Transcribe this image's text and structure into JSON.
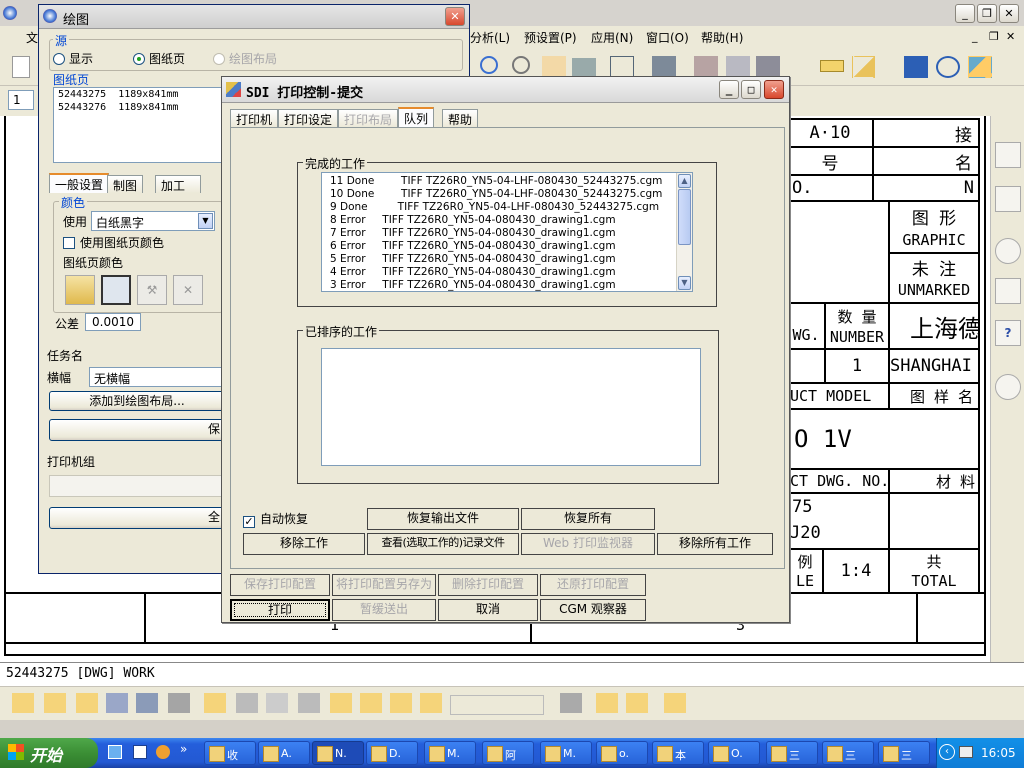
{
  "app": {
    "menu": [
      "分析(L)",
      "预设置(P)",
      "应用(N)",
      "窗口(O)",
      "帮助(H)"
    ],
    "left_menu_stub": "文",
    "zoom_field": "1"
  },
  "drawing": {
    "cells": {
      "a10": "A·10",
      "hao": "号",
      "no": "O.",
      "jie": "接",
      "ming": "名",
      "n": "N",
      "tuxing": "图 形",
      "graphic": "GRAPHIC",
      "weizhu": "未 注",
      "unmarked": "UNMARKED",
      "wg": "WG.",
      "shuliang": "数 量",
      "number": "NUMBER",
      "one": "1",
      "shanghai_cn": "上海德",
      "shanghai_en": "SHANGHAI",
      "uct_model": "UCT MODEL",
      "tuyangming": "图 样 名",
      "o1v": "O 1V",
      "ct_dwg": "CT DWG. NO.",
      "cailiao": "材 料",
      "n75": "75",
      "j20": "J20",
      "li": "例",
      "le": "LE",
      "scale": "1:4",
      "gong": "共",
      "total": "TOTAL",
      "bottom_a": "1",
      "bottom_b": "3"
    },
    "status": "52443275 [DWG] WORK"
  },
  "plot_window": {
    "title": "绘图",
    "source_group": "源",
    "radio_display": "显示",
    "radio_sheet": "图纸页",
    "radio_layout": "绘图布局",
    "sheets_group": "图纸页",
    "sheets": [
      {
        "name": "52443275",
        "size": "1189x841mm"
      },
      {
        "name": "52443276",
        "size": "1189x841mm"
      }
    ],
    "tabs": [
      "一般设置",
      "制图",
      "加工"
    ],
    "color_group": "颜色",
    "use_label": "使用",
    "use_value": "白纸黑字",
    "use_sheet_color": "使用图纸页颜色",
    "sheet_color_label": "图纸页颜色",
    "tolerance_label": "公差",
    "tolerance_value": "0.0010",
    "task_name_label": "任务名",
    "banner_label": "横幅",
    "banner_value": "无横幅",
    "add_to_layout": "添加到绘图布局...",
    "save_btn": "保",
    "printer_group_label": "打印机组",
    "all_btn": "全"
  },
  "sdi": {
    "title": "SDI 打印控制-提交",
    "tabs": [
      {
        "label": "打印机",
        "state": "normal"
      },
      {
        "label": "打印设定",
        "state": "normal"
      },
      {
        "label": "打印布局",
        "state": "disabled"
      },
      {
        "label": "队列",
        "state": "selected"
      },
      {
        "label": "帮助",
        "state": "normal"
      }
    ],
    "completed_group": "完成的工作",
    "completed_jobs": [
      "11 Done        TIFF TZ26R0_YN5-04-LHF-080430_52443275.cgm",
      "10 Done        TIFF TZ26R0_YN5-04-LHF-080430_52443275.cgm",
      "9 Done         TIFF TZ26R0_YN5-04-LHF-080430_52443275.cgm",
      "8 Error     TIFF TZ26R0_YN5-04-080430_drawing1.cgm",
      "7 Error     TIFF TZ26R0_YN5-04-080430_drawing1.cgm",
      "6 Error     TIFF TZ26R0_YN5-04-080430_drawing1.cgm",
      "5 Error     TIFF TZ26R0_YN5-04-080430_drawing1.cgm",
      "4 Error     TIFF TZ26R0_YN5-04-080430_drawing1.cgm",
      "3 Error     TIFF TZ26R0_YN5-04-080430_drawing1.cgm"
    ],
    "sorted_group": "已排序的工作",
    "auto_recover": "自动恢复",
    "btn_recover_output": "恢复输出文件",
    "btn_recover_all": "恢复所有",
    "btn_remove_job": "移除工作",
    "btn_view_log": "查看(选取工作的)记录文件",
    "btn_web_monitor": "Web 打印监视器",
    "btn_remove_all": "移除所有工作",
    "btn_save_config": "保存打印配置",
    "btn_save_as": "将打印配置另存为",
    "btn_delete_config": "删除打印配置",
    "btn_restore_config": "还原打印配置",
    "btn_print": "打印",
    "btn_hold": "暂缓送出",
    "btn_cancel": "取消",
    "btn_cgm": "CGM 观察器"
  },
  "taskbar": {
    "start": "开始",
    "tasks": [
      "收",
      "A.",
      "N.",
      "D.",
      "M.",
      "阿",
      "M.",
      "o.",
      "本",
      "O.",
      "三",
      "三",
      "三"
    ],
    "clock": "16:05"
  },
  "colors": {
    "xp_blue": "#245edb",
    "start_green": "#3b8f35",
    "group_label_blue": "#0046d5",
    "close_red": "#d8482e"
  }
}
